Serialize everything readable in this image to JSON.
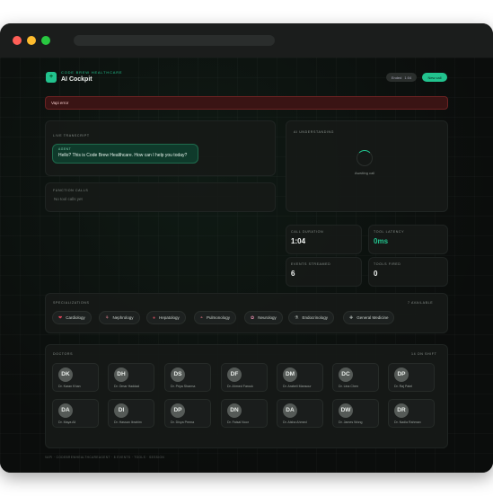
{
  "window": {
    "colors": {
      "close": "#ff5f57",
      "min": "#febc2e",
      "max": "#28c840",
      "accent": "#22c38e"
    }
  },
  "header": {
    "brand": "CODE BREW HEALTHCARE",
    "title": "AI Cockpit",
    "status_label": "Ended",
    "timer": "1:04",
    "new_call_label": "New call"
  },
  "error": {
    "text": "Vapi error"
  },
  "transcript": {
    "title": "LIVE TRANSCRIPT",
    "messages": [
      {
        "role": "AGENT",
        "text": "Hello? This is Code Brew Healthcare. How can I help you today?"
      }
    ]
  },
  "function_calls": {
    "title": "FUNCTION CALLS",
    "empty": "No tool calls yet"
  },
  "ai_understanding": {
    "title": "AI UNDERSTANDING",
    "status": "Awaiting call"
  },
  "metrics": [
    {
      "label": "CALL DURATION",
      "value": "1:04",
      "accent": false
    },
    {
      "label": "TOOL LATENCY",
      "value": "0ms",
      "accent": true
    },
    {
      "label": "EVENTS STREAMED",
      "value": "6",
      "accent": false
    },
    {
      "label": "TOOLS FIRED",
      "value": "0",
      "accent": false
    }
  ],
  "specializations": {
    "title": "SPECIALIZATIONS",
    "count": "7 AVAILABLE",
    "items": [
      {
        "label": "Cardiology",
        "icon": "heart-icon",
        "glyph": "❤"
      },
      {
        "label": "Nephrology",
        "icon": "kidney-icon",
        "glyph": "⚘"
      },
      {
        "label": "Hepatology",
        "icon": "liver-icon",
        "glyph": "●"
      },
      {
        "label": "Pulmonology",
        "icon": "lungs-icon",
        "glyph": "◓"
      },
      {
        "label": "Neurology",
        "icon": "brain-icon",
        "glyph": "✿"
      },
      {
        "label": "Endocrinology",
        "icon": "gland-icon",
        "glyph": "⚗"
      },
      {
        "label": "General Medicine",
        "icon": "stethoscope-icon",
        "glyph": "✚"
      }
    ]
  },
  "doctors": {
    "title": "DOCTORS",
    "count": "14 ON SHIFT",
    "items": [
      {
        "initials": "DK",
        "name": "Dr. Karan Khan"
      },
      {
        "initials": "DH",
        "name": "Dr. Omar Haddad"
      },
      {
        "initials": "DS",
        "name": "Dr. Priya Sharma"
      },
      {
        "initials": "DF",
        "name": "Dr. Ahmed Farouk"
      },
      {
        "initials": "DM",
        "name": "Dr. Arabeli Mansour"
      },
      {
        "initials": "DC",
        "name": "Dr. Lina Chen"
      },
      {
        "initials": "DP",
        "name": "Dr. Raj Patel"
      },
      {
        "initials": "DA",
        "name": "Dr. Maya Ali"
      },
      {
        "initials": "DI",
        "name": "Dr. Hassan Ibrahim"
      },
      {
        "initials": "DP",
        "name": "Dr. Divya Prema"
      },
      {
        "initials": "DN",
        "name": "Dr. Faisal Noor"
      },
      {
        "initials": "DA",
        "name": "Dr. Aisha Ahmed"
      },
      {
        "initials": "DW",
        "name": "Dr. James Wong"
      },
      {
        "initials": "DR",
        "name": "Dr. Nadia Rahman"
      }
    ]
  },
  "footer": {
    "text": "VAPI · CODEBREWHEALTHCAREAGENT · 8 EVENTS · TOOLS · SESSION"
  }
}
